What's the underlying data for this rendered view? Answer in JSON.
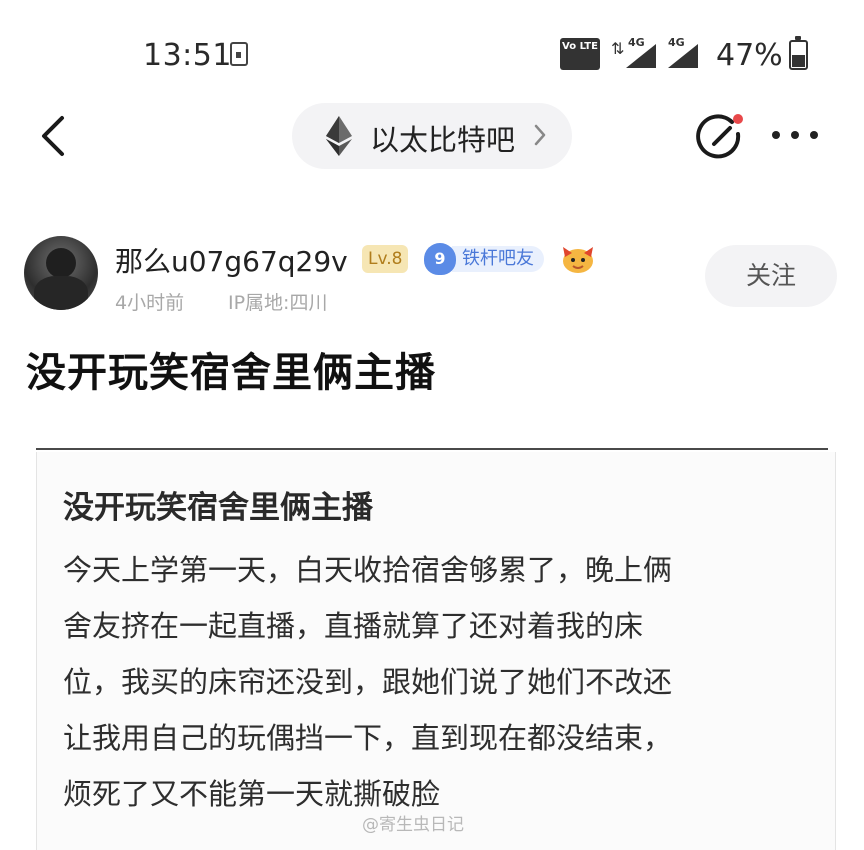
{
  "status_bar": {
    "time": "13:51",
    "notification_icon": "download-notification-icon",
    "volte_label": "Vo LTE",
    "signal_1_label": "4G",
    "signal_2_label": "4G",
    "battery_percent": "47%"
  },
  "nav": {
    "back_icon": "chevron-left-icon",
    "forum_icon": "ethereum-icon",
    "forum_name": "以太比特吧",
    "forum_chevron_icon": "chevron-right-icon",
    "edit_icon": "edit-pen-icon",
    "more_icon": "more-dots-icon"
  },
  "author": {
    "username": "那么u07g67q29v",
    "level": "Lv.8",
    "fan_level": "9",
    "fan_title": "铁杆吧友",
    "emoji_icon": "emoji-badge-icon",
    "time_ago": "4小时前",
    "ip_location": "IP属地:四川",
    "follow_label": "关注"
  },
  "post": {
    "title": "没开玩笑宿舍里俩主播"
  },
  "embedded_note": {
    "title": "没开玩笑宿舍里俩主播",
    "lines": [
      "今天上学第一天，白天收拾宿舍够累了，晚上俩",
      "舍友挤在一起直播，直播就算了还对着我的床",
      "位，我买的床帘还没到，跟她们说了她们不改还",
      "让我用自己的玩偶挡一下，直到现在都没结束，",
      "烦死了又不能第一天就撕破脸"
    ],
    "watermark": "@寄生虫日记"
  },
  "colors": {
    "accent_red": "#e8484a",
    "level_badge_bg": "#f6e6b4",
    "fan_badge_blue": "#5b8be6"
  }
}
